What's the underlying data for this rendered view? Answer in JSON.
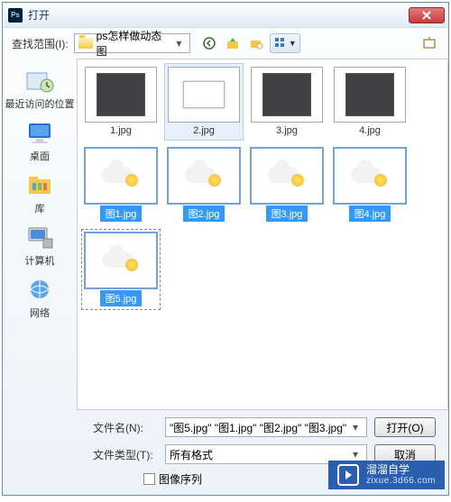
{
  "title": "打开",
  "lookin_label": "查找范围(I):",
  "lookin_value": "ps怎样做动态图",
  "sidebar": [
    {
      "label": "最近访问的位置",
      "name": "recent"
    },
    {
      "label": "桌面",
      "name": "desktop"
    },
    {
      "label": "库",
      "name": "libraries"
    },
    {
      "label": "计算机",
      "name": "computer"
    },
    {
      "label": "网络",
      "name": "network"
    }
  ],
  "files": [
    {
      "name": "1.jpg",
      "kind": "ps-a",
      "selected": false
    },
    {
      "name": "2.jpg",
      "kind": "ps-b",
      "selected": false,
      "hover": true
    },
    {
      "name": "3.jpg",
      "kind": "ps-a",
      "selected": false
    },
    {
      "name": "4.jpg",
      "kind": "ps-a",
      "selected": false
    },
    {
      "name": "图1.jpg",
      "kind": "weather",
      "selected": true
    },
    {
      "name": "图2.jpg",
      "kind": "weather",
      "selected": true
    },
    {
      "name": "图3.jpg",
      "kind": "weather",
      "selected": true
    },
    {
      "name": "图4.jpg",
      "kind": "weather",
      "selected": true
    },
    {
      "name": "图5.jpg",
      "kind": "weather",
      "selected": true,
      "dotted": true
    }
  ],
  "filename_label": "文件名(N):",
  "filename_value": "\"图5.jpg\" \"图1.jpg\" \"图2.jpg\" \"图3.jpg\"",
  "filetype_label": "文件类型(T):",
  "filetype_value": "所有格式",
  "open_btn": "打开(O)",
  "cancel_btn": "取消",
  "sequence_label": "图像序列",
  "watermark": {
    "title": "溜溜自学",
    "sub": "zixue.3d66.com"
  }
}
